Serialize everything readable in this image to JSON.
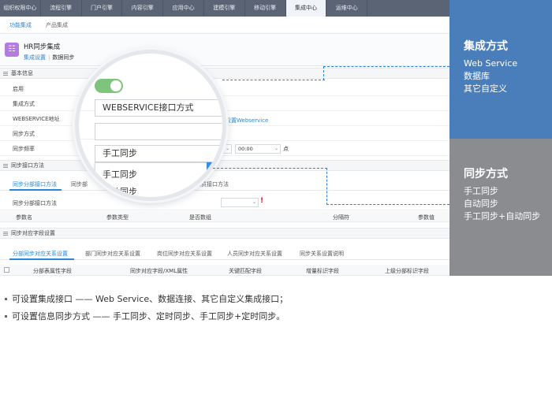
{
  "topnav": [
    "组织权限中心",
    "流程引擎",
    "门户引擎",
    "内容引擎",
    "应用中心",
    "建模引擎",
    "移动引擎",
    "集成中心",
    "运维中心"
  ],
  "subnav": [
    "功能集成",
    "产品集成"
  ],
  "header": {
    "icon": "database-icon",
    "title": "HR同步集成",
    "link1": "集成设置",
    "sep": "|",
    "link2": "数据同步"
  },
  "basic": {
    "title": "基本信息",
    "enable_label": "启用",
    "method_label": "集成方式",
    "method_value": "WEBSERVICE接口方式",
    "ws_label": "WEBSERVICE地址",
    "ws_link": "设置Webservice",
    "sync_label": "同步方式",
    "sync_value": "手工同步",
    "freq_label": "同步频率",
    "freq_time": "00:00",
    "freq_unit": "点"
  },
  "iface": {
    "title": "同步接口方法",
    "tabs": [
      "同步分部接口方法",
      "同步部",
      "步人员接口方法"
    ],
    "method_label": "同步分部接口方法",
    "required_mark": "!",
    "cols": [
      "参数名",
      "参数类型",
      "是否数组",
      "分隔符",
      "参数值"
    ]
  },
  "mapping": {
    "title": "同步对应字段设置",
    "tabs": [
      "分部同步对应关系设置",
      "部门同步对应关系设置",
      "岗位同步对应关系设置",
      "人员同步对应关系设置",
      "同步关系设置说明"
    ],
    "cols": [
      "分部表属性字段",
      "同步对应字段/XML属性",
      "关键匹配字段",
      "增量标识字段",
      "上级分部标识字段"
    ]
  },
  "magnifier": {
    "method_value": "WEBSERVICE接口方式",
    "sync_value": "手工同步",
    "options": [
      "手工同步",
      "自动同步"
    ]
  },
  "panels": [
    {
      "title": "集成方式",
      "items": [
        "Web Service",
        "数据库",
        "其它自定义"
      ],
      "color": "#4a7ebb"
    },
    {
      "title": "同步方式",
      "items": [
        "手工同步",
        "自动同步",
        "手工同步+自动同步"
      ],
      "color": "#8a8c8f"
    }
  ],
  "bullets": [
    "可设置集成接口 —— Web Service、数据连接、其它自定义集成接口；",
    "可设置信息同步方式 —— 手工同步、定时同步、手工同步+定时同步。"
  ],
  "colors": {
    "accent": "#2a86d6",
    "nav_bg": "#5a6475",
    "panel_blue": "#4a7ebb",
    "panel_gray": "#8a8c8f",
    "toggle_on": "#7ec47c"
  }
}
